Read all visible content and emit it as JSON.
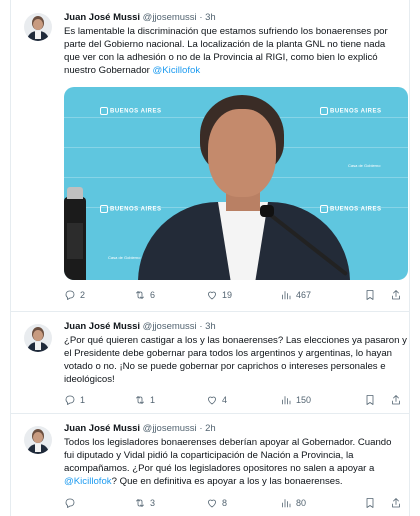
{
  "tweets": [
    {
      "author_name": "Juan José Mussi",
      "handle": "@jjosemussi",
      "separator": "·",
      "time": "3h",
      "lines": [
        "Es lamentable la discriminación que estamos sufriendo los bonaerenses por",
        "parte del Gobierno nacional. La localización de la planta GNL no tiene nada",
        "que ver con la adhesión o no de la Provincia al RIGI, como bien lo explicó",
        "nuestro Gobernador "
      ],
      "mention": "@Kicillofok",
      "replies": "2",
      "retweets": "6",
      "likes": "19",
      "views": "467",
      "media": {
        "logo_text": "BUENOS AIRES",
        "caption": "Casa de Gobierno"
      }
    },
    {
      "author_name": "Juan José Mussi",
      "handle": "@jjosemussi",
      "separator": "·",
      "time": "3h",
      "lines": [
        "¿Por qué quieren castigar a los y las bonaerenses? Las elecciones ya pasaron y",
        "el Presidente debe gobernar para todos los argentinos y argentinas, lo hayan",
        "votado o no. ¡No se puede gobernar por caprichos o intereses personales e",
        "ideológicos!"
      ],
      "replies": "1",
      "retweets": "1",
      "likes": "4",
      "views": "150"
    },
    {
      "author_name": "Juan José Mussi",
      "handle": "@jjosemussi",
      "separator": "·",
      "time": "2h",
      "lines": [
        "Todos los legisladores bonaerenses deberían apoyar al Gobernador. Cuando",
        "fui diputado y Vidal pidió la coparticipación de Nación a Provincia, la",
        "acompañamos. ¿Por qué los legisladores opositores no salen a apoyar a",
        "? Que en definitiva es apoyar a los y las bonaerenses."
      ],
      "mention": "@Kicillofok",
      "replies": "",
      "retweets": "3",
      "likes": "8",
      "views": "80"
    }
  ],
  "icons": {
    "reply": "reply-icon",
    "retweet": "retweet-icon",
    "like": "heart-icon",
    "views": "views-icon",
    "bookmark": "bookmark-icon",
    "share": "share-icon"
  },
  "colors": {
    "link": "#1d9bf0",
    "muted": "#536471",
    "text": "#0f1419",
    "media_bg": "#5fc6df"
  }
}
